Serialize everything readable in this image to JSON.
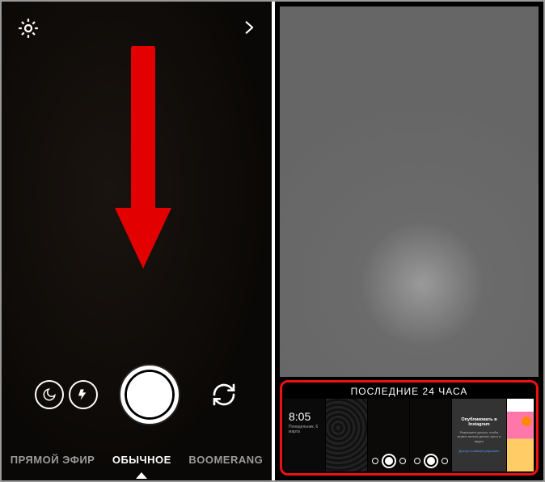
{
  "left": {
    "modes": {
      "live": "ПРЯМОЙ ЭФИР",
      "normal": "ОБЫЧНОЕ",
      "boomerang": "BOOMERANG"
    }
  },
  "right": {
    "gallery_title": "ПОСЛЕДНИЕ 24 ЧАСА",
    "thumb1": {
      "time": "8:05",
      "date": "Понедельник, 6 марта"
    },
    "thumb5": {
      "headline": "Опубликовать в Instagram",
      "sub": "Разрешите доступ, чтобы можно нельзя делать фото и видео",
      "link": "Доступ к камере разрешен"
    }
  }
}
